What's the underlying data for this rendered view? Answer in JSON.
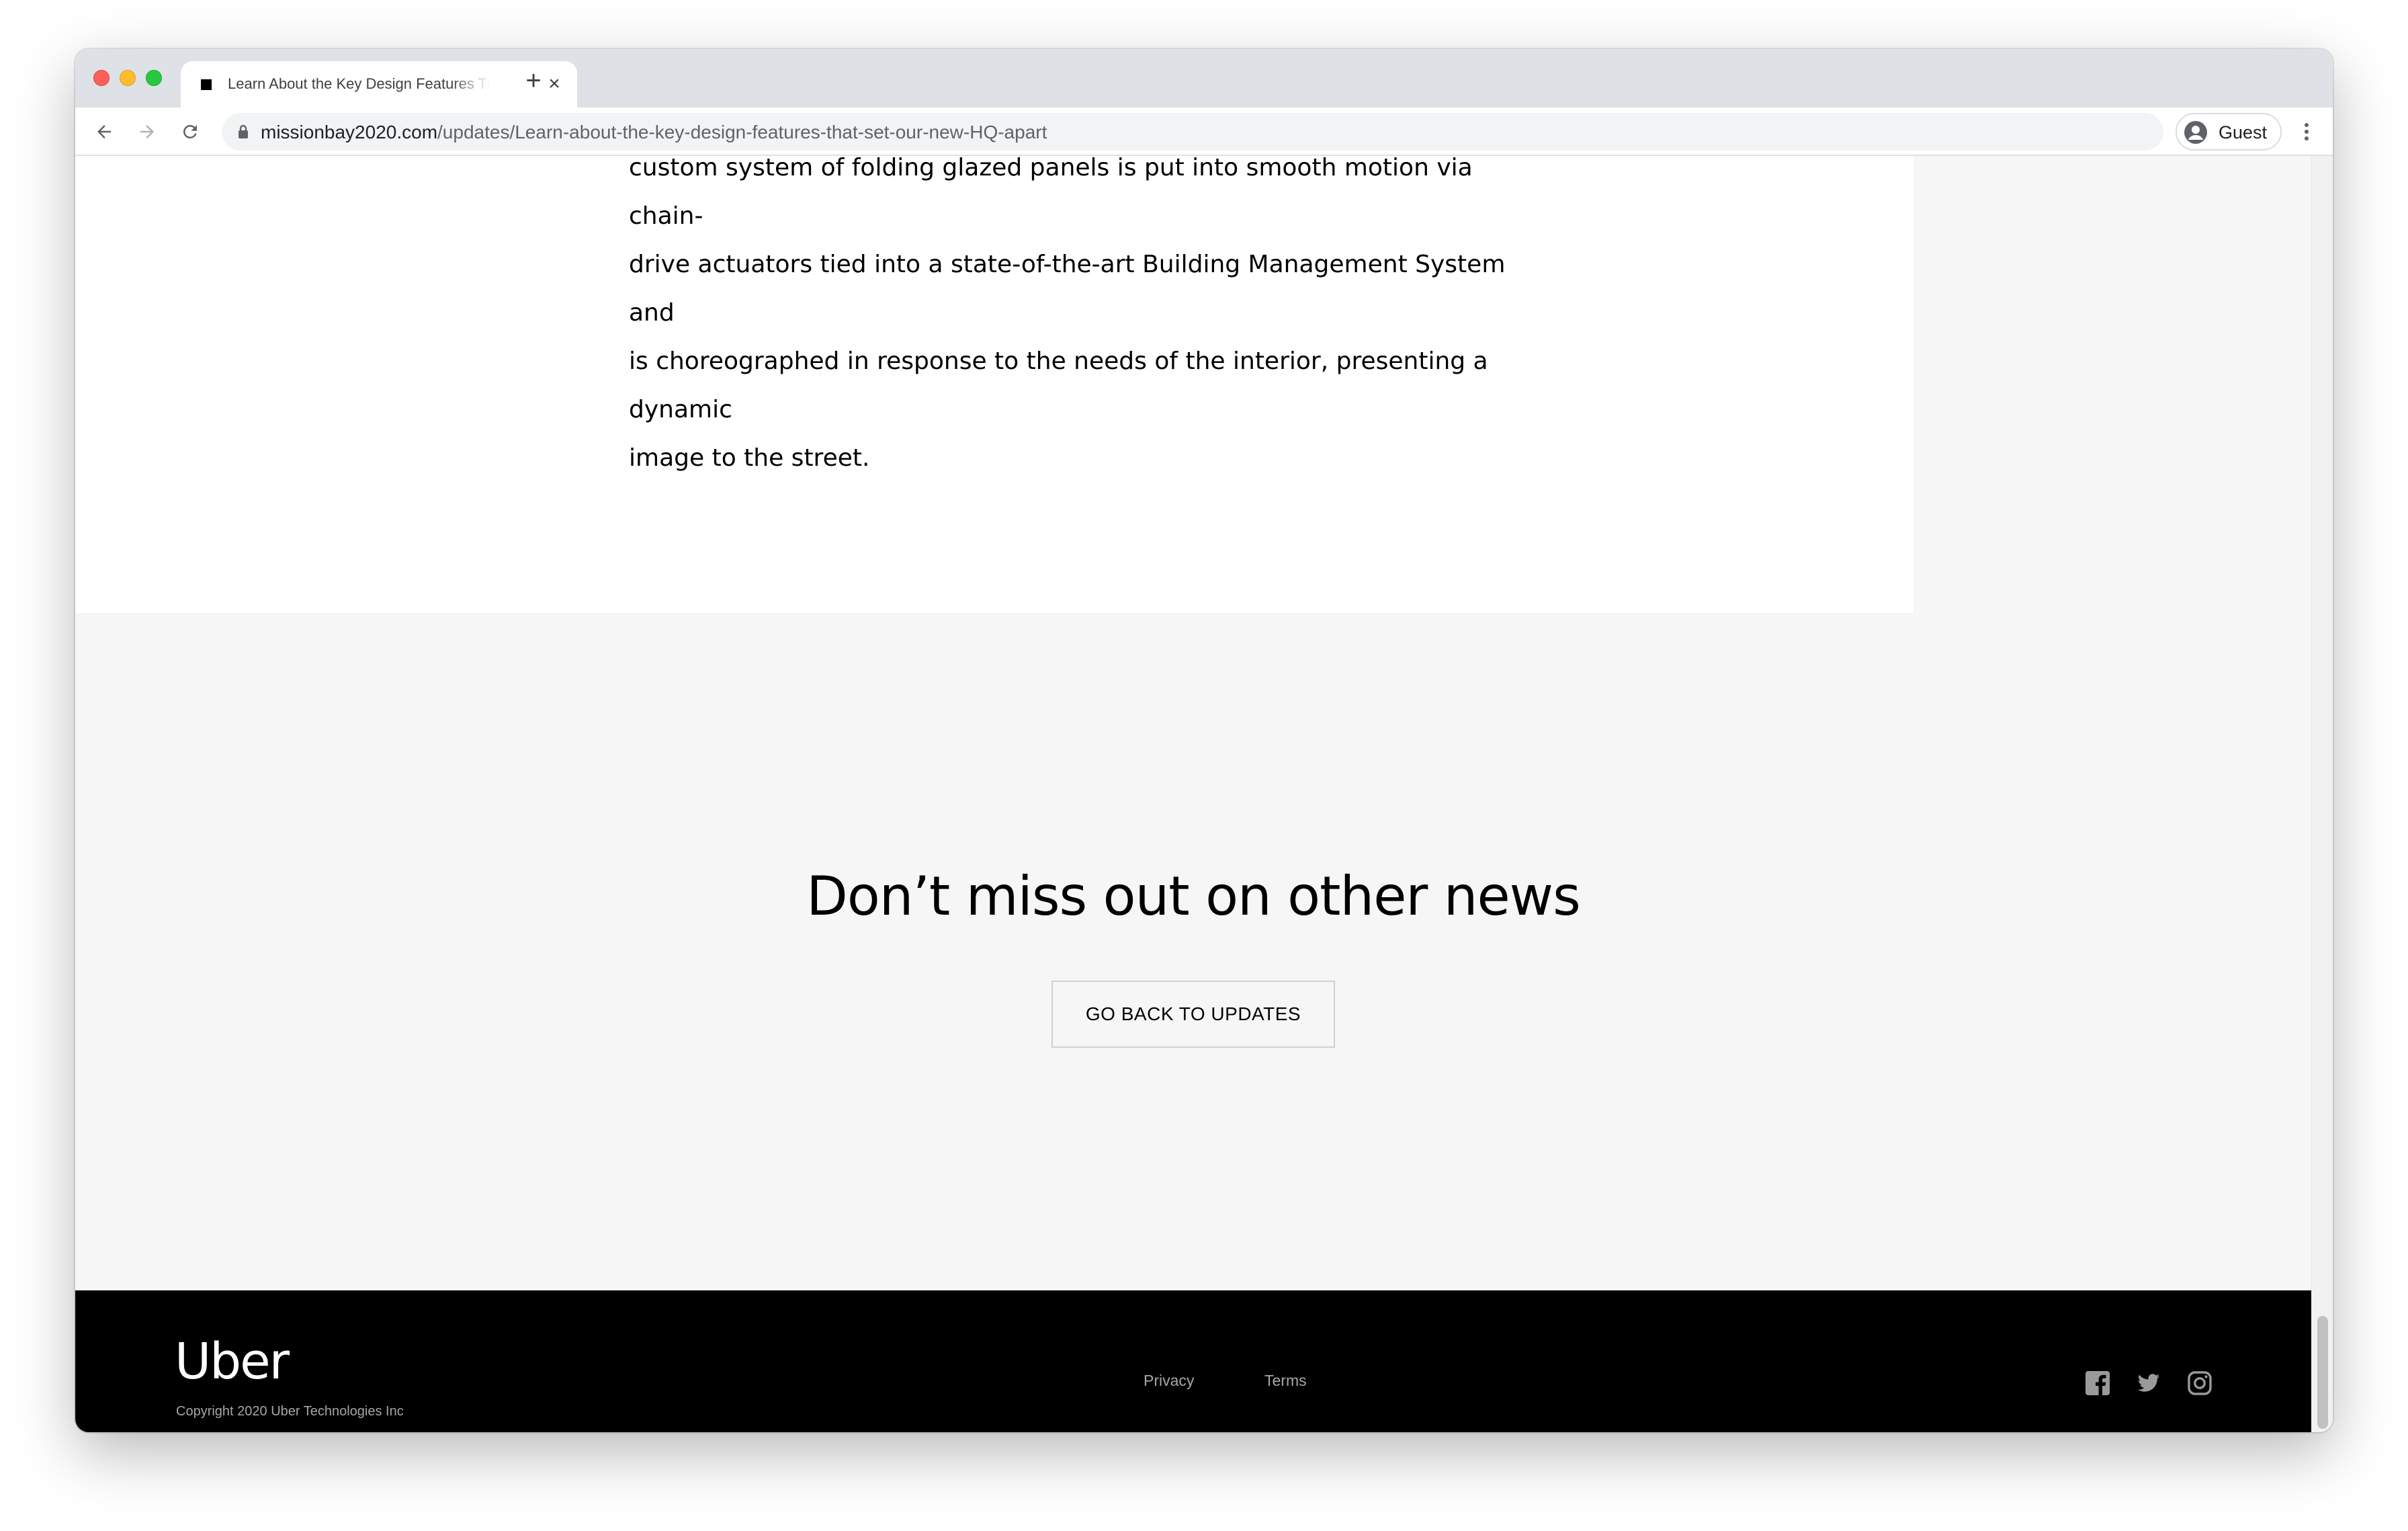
{
  "browser": {
    "tab": {
      "title": "Learn About the Key Design Features That Set Our New HQ Apart"
    },
    "url": {
      "host": "missionbay2020.com",
      "path": "/updates/Learn-about-the-key-design-features-that-set-our-new-HQ-apart"
    },
    "profile": {
      "label": "Guest"
    },
    "icons": {
      "back": "arrow-left-icon",
      "forward": "arrow-right-icon",
      "reload": "reload-icon",
      "lock": "lock-icon",
      "new_tab": "plus-icon",
      "close_tab": "close-icon",
      "menu": "kebab-menu-icon"
    }
  },
  "article": {
    "lines": [
      "custom system of folding glazed panels is put into smooth motion via chain-",
      "drive actuators tied into a state-of-the-art Building Management System and",
      "is choreographed in response to the needs of the interior, presenting a dynamic",
      "image to the street."
    ]
  },
  "cta": {
    "heading": "Don’t miss out on other news",
    "button_label": "GO BACK TO UPDATES"
  },
  "footer": {
    "logo": "Uber",
    "copyright": "Copyright 2020 Uber Technologies Inc",
    "links": {
      "privacy": "Privacy",
      "terms": "Terms"
    },
    "social_icons": [
      "facebook-icon",
      "twitter-icon",
      "instagram-icon"
    ]
  },
  "colors": {
    "tab_strip": "#dee1e6",
    "page_background": "#f6f6f6",
    "footer_background": "#000000",
    "footer_text": "#a6a6a6",
    "text": "#000000"
  }
}
